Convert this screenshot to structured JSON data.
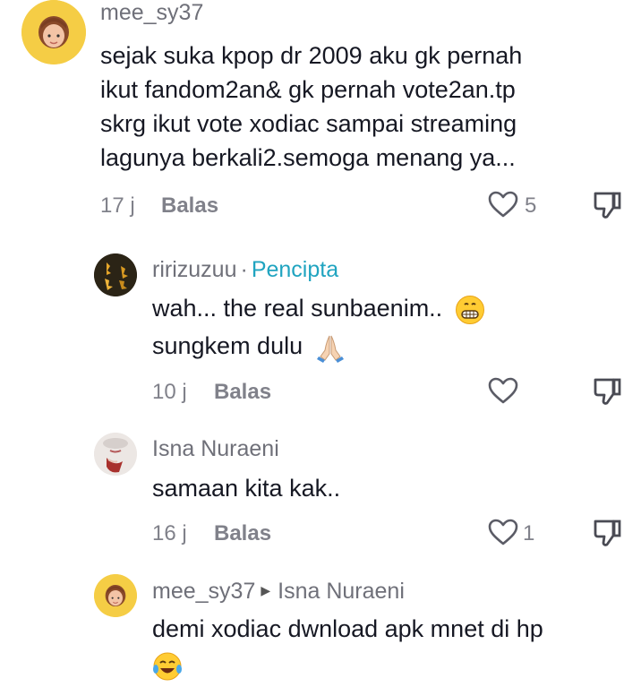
{
  "comments": [
    {
      "username": "mee_sy37",
      "text_lines": [
        "sejak suka kpop dr 2009 aku gk pernah",
        "ikut fandom2an& gk pernah vote2an.tp",
        "skrg ikut vote xodiac sampai streaming",
        "lagunya berkali2.semoga menang ya..."
      ],
      "time": "17 j",
      "reply_label": "Balas",
      "likes": "5"
    },
    {
      "username": "ririzuzuu",
      "separator": "·",
      "creator_label": "Pencipta",
      "text_lines": [
        "wah... the real sunbaenim..",
        "sungkem dulu"
      ],
      "time": "10 j",
      "reply_label": "Balas",
      "likes": ""
    },
    {
      "username": "Isna Nuraeni",
      "text_lines": [
        "samaan kita kak.."
      ],
      "time": "16 j",
      "reply_label": "Balas",
      "likes": "1"
    },
    {
      "username": "mee_sy37",
      "reply_to": "Isna Nuraeni",
      "text_lines": [
        "demi xodiac dwnload apk mnet di hp"
      ],
      "time": "",
      "reply_label": "",
      "likes": ""
    }
  ],
  "icons": {
    "like": "heart-outline-icon",
    "dislike": "thumbs-down-icon",
    "grin": "grinning-emoji",
    "pray": "praying-hands-emoji",
    "laugh": "tears-of-joy-emoji"
  },
  "colors": {
    "creator": "#20a4c0",
    "muted": "#80818a",
    "text": "#161823"
  }
}
